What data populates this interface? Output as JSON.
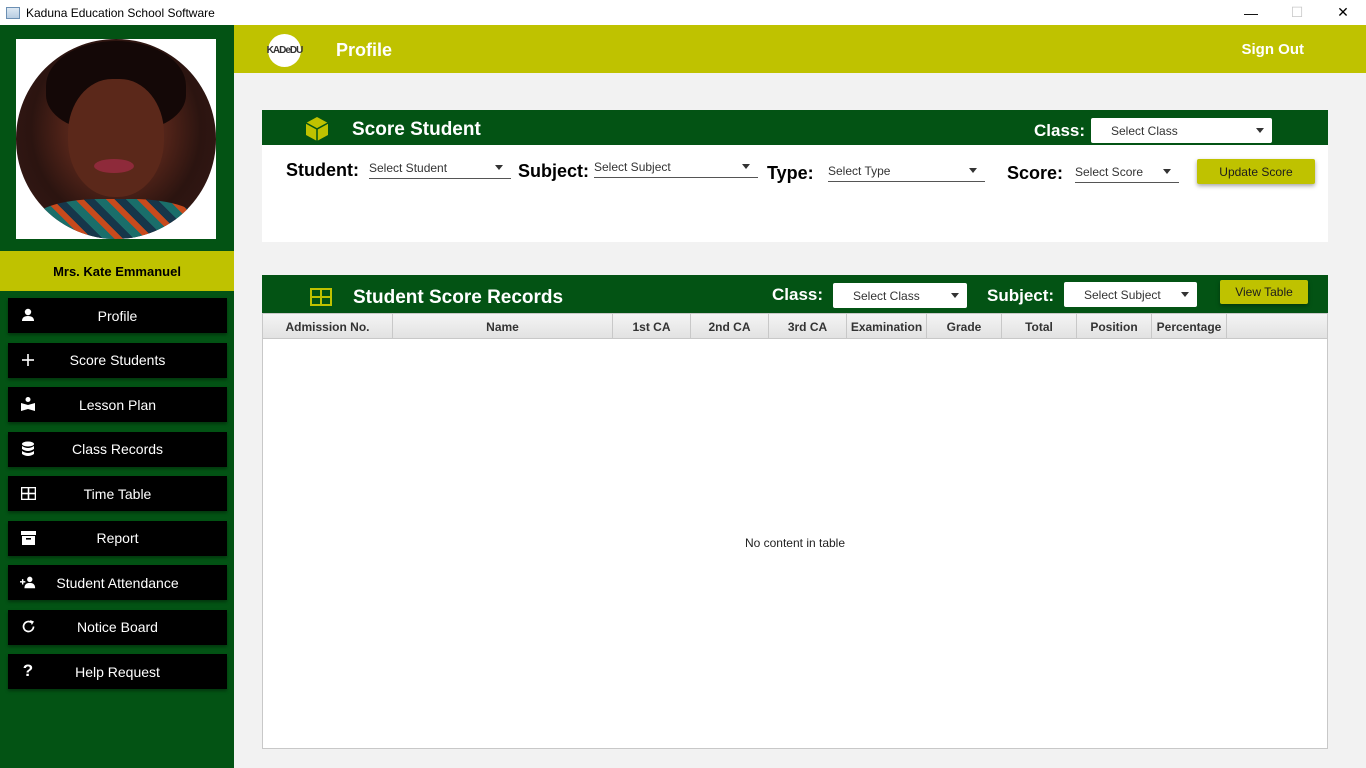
{
  "window": {
    "title": "Kaduna Education School Software",
    "controls": {
      "minimize": "—",
      "maximize": "☐",
      "close": "✕"
    }
  },
  "sidebar": {
    "user_name": "Mrs.  Kate Emmanuel",
    "items": [
      {
        "label": "Profile",
        "icon": "person-icon"
      },
      {
        "label": "Score Students",
        "icon": "plus-icon"
      },
      {
        "label": "Lesson Plan",
        "icon": "book-reader-icon"
      },
      {
        "label": "Class Records",
        "icon": "database-icon"
      },
      {
        "label": "Time Table",
        "icon": "table-icon"
      },
      {
        "label": "Report",
        "icon": "archive-icon"
      },
      {
        "label": "Student Attendance",
        "icon": "add-user-icon"
      },
      {
        "label": "Notice Board",
        "icon": "refresh-icon"
      },
      {
        "label": "Help Request",
        "icon": "question-icon"
      }
    ]
  },
  "header": {
    "logo_text": "KADeDU",
    "title": "Profile",
    "sign_out": "Sign Out"
  },
  "score_student": {
    "title": "Score Student",
    "class_label": "Class:",
    "class_placeholder": "Select Class",
    "student_label": "Student:",
    "student_placeholder": "Select Student",
    "subject_label": "Subject:",
    "subject_placeholder": "Select Subject",
    "type_label": "Type:",
    "type_placeholder": "Select Type",
    "score_label": "Score:",
    "score_placeholder": "Select Score",
    "update_button": "Update Score"
  },
  "records": {
    "title": "Student Score Records",
    "class_label": "Class:",
    "class_placeholder": "Select Class",
    "subject_label": "Subject:",
    "subject_placeholder": "Select Subject",
    "view_button": "View Table",
    "columns": [
      "Admission No.",
      "Name",
      "1st CA",
      "2nd CA",
      "3rd CA",
      "Examination",
      "Grade",
      "Total",
      "Position",
      "Percentage"
    ],
    "empty_message": "No content in table"
  },
  "colors": {
    "dark_green": "#035314",
    "olive": "#bfc200",
    "nav_black": "#000000"
  }
}
